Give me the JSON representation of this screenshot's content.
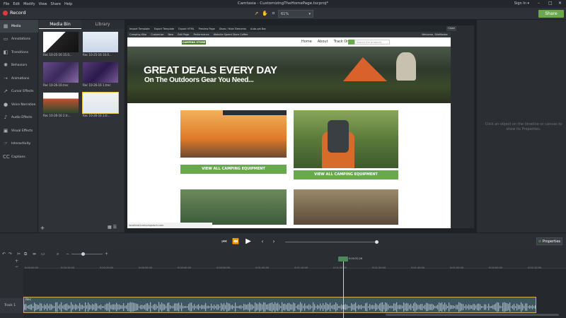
{
  "menu": [
    "File",
    "Edit",
    "Modify",
    "View",
    "Share",
    "Help"
  ],
  "app_title": "Camtasia - CustomizingTheHomePage.tscproj*",
  "sign_in": "Sign In ▾",
  "toolbar": {
    "record": "Record",
    "zoom": "61%",
    "share": "Share"
  },
  "tools": [
    {
      "label": "Media",
      "icon": "media-icon"
    },
    {
      "label": "Annotations",
      "icon": "annotations-icon"
    },
    {
      "label": "Transitions",
      "icon": "transitions-icon"
    },
    {
      "label": "Behaviors",
      "icon": "behaviors-icon"
    },
    {
      "label": "Animations",
      "icon": "animations-icon"
    },
    {
      "label": "Cursor Effects",
      "icon": "cursor-effects-icon"
    },
    {
      "label": "Voice Narration",
      "icon": "voice-narration-icon"
    },
    {
      "label": "Audio Effects",
      "icon": "audio-effects-icon"
    },
    {
      "label": "Visual Effects",
      "icon": "visual-effects-icon"
    },
    {
      "label": "Interactivity",
      "icon": "interactivity-icon"
    },
    {
      "label": "Captions",
      "icon": "captions-icon"
    }
  ],
  "media_bin": {
    "tabs": [
      "Media Bin",
      "Library"
    ],
    "items": [
      "Rec 10-25-16 15.0...",
      "Rec 10-25-16 10.0...",
      "Rec 10-26-16.trec",
      "Rec 10-26-16 1.trec",
      "Rec 10-26-16 2.tr...",
      "Rec 10-26-16 3.tr..."
    ]
  },
  "webpage": {
    "wp_bar": [
      "Import Template",
      "Export Template",
      "Export HTML",
      "Preview Page",
      "Show / Hide Elements",
      "Auto-set Bar"
    ],
    "wp_bar2": [
      "Camping Kiko",
      "Customize",
      "New",
      "Edit Page",
      "Performance",
      "Website Speed Store Coffee",
      "Welcome, SiteMaster"
    ],
    "nav": [
      "Home",
      "About",
      "Track Order"
    ],
    "search_placeholder": "Search the products",
    "logo": "CAMPING STORE",
    "hero_line1": "GREAT DEALS EVERY DAY",
    "hero_line2": "On The Outdoors Gear You Need...",
    "cta1": "VIEW ALL CAMPING EQUIPMENT",
    "cta2": "VIEW ALL CAMPING EQUIPMENT",
    "status_url": "localhost/campingstore.com",
    "close": "Close"
  },
  "properties": {
    "message": "Click an object on the timeline or canvas to show its Properties.",
    "button": "Properties"
  },
  "timeline": {
    "ticks": [
      "0:00:00;00",
      "0:00:10;00",
      "0:00:20;00",
      "0:00:30;00",
      "0:00:40;00",
      "0:00:50;00",
      "0:01:00;00",
      "0:01:10;00",
      "0:01:20;00",
      "0:01:30;00",
      "0:01:40;00",
      "0:01:50;00",
      "0:02:00;00",
      "0:02:10;00",
      "0:02:20;00"
    ],
    "playhead_time": "0:00:32;26",
    "track_label": "Track 1",
    "clip_label": "Rec"
  }
}
